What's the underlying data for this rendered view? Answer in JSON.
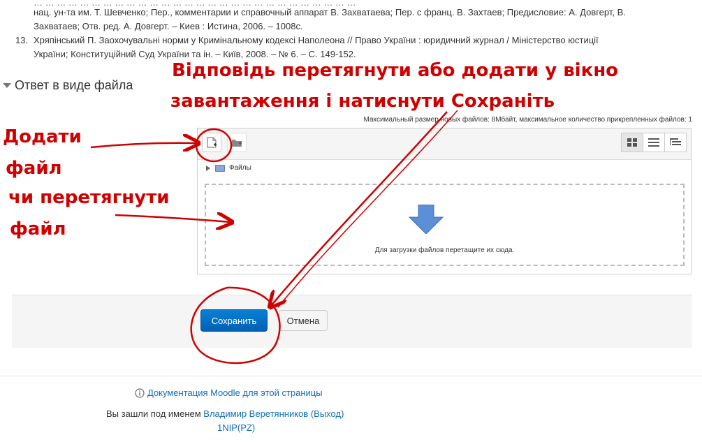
{
  "references": {
    "line1": "нац. ун-та им. Т. Шевченко; Пер., комментарии и справочный аппарат В. Захватаева; Пер. с франц. В. Захтаев; Предисловие: А. Довгерт, В.",
    "line2": "Захватаев; Отв. ред. А. Довгерт. – Киев : Истина, 2006. – 1008с.",
    "item13_number": "13.",
    "item13_line1": "Хряпінський П. Заохочувальні норми у Кримінальному кодексі Наполеона // Право України : юридичний журнал / Міністерство юстиції",
    "item13_line2": "України; Конституційний Суд України та ін. – Київ, 2008. – № 6. – С. 149-152."
  },
  "section": {
    "title": "Ответ в виде файла"
  },
  "filepicker": {
    "limits": "Максимальный размер новых файлов: 8Мбайт, максимальное количество прикрепленных файлов: 1",
    "folder_label": "Файлы",
    "drop_message": "Для загрузки файлов перетащите их сюда.",
    "buttons": [
      "add-file",
      "create-folder"
    ],
    "views": [
      "icons-view",
      "list-view",
      "tree-view"
    ]
  },
  "actions": {
    "save_label": "Сохранить",
    "cancel_label": "Отмена"
  },
  "footer": {
    "doc_link": "Документация Moodle для этой страницы",
    "logged_prefix": "Вы зашли под именем",
    "user_name": "Владимир Веретянников",
    "logout_open": "(",
    "logout_label": "Выход",
    "logout_close": ")",
    "course_short": "1NIP(PZ)"
  },
  "annotations": {
    "top_line1": "Відповідь перетягнути або додати у вікно",
    "top_line2": "завантаження і натиснути Сохраніть",
    "left_line1": "Додати",
    "left_line2": "файл",
    "left_line3": "чи перетягнути",
    "left_line4": "файл"
  },
  "colors": {
    "annotation": "#d00000",
    "primary_button": "#0070c9",
    "link": "#0f6fb7"
  }
}
